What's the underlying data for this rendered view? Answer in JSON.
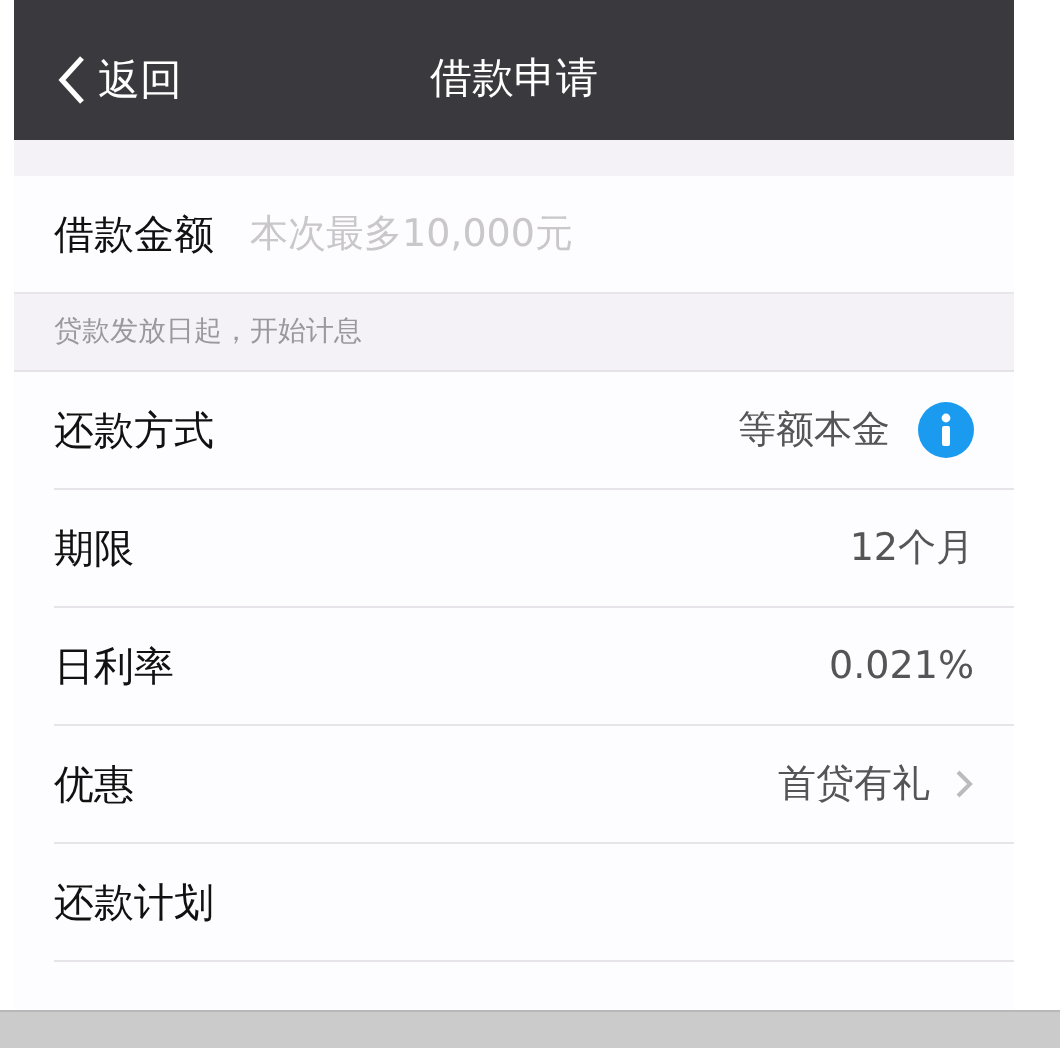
{
  "nav": {
    "back_label": "返回",
    "title": "借款申请"
  },
  "amount": {
    "label": "借款金额",
    "placeholder": "本次最多10,000元"
  },
  "note": "贷款发放日起，开始计息",
  "rows": [
    {
      "label": "还款方式",
      "value": "等额本金",
      "kind": "info"
    },
    {
      "label": "期限",
      "value": "12个月",
      "kind": "plain"
    },
    {
      "label": "日利率",
      "value": "0.021%",
      "kind": "plain"
    },
    {
      "label": "优惠",
      "value": "首贷有礼",
      "kind": "link"
    },
    {
      "label": "还款计划",
      "kind": "plain"
    }
  ]
}
